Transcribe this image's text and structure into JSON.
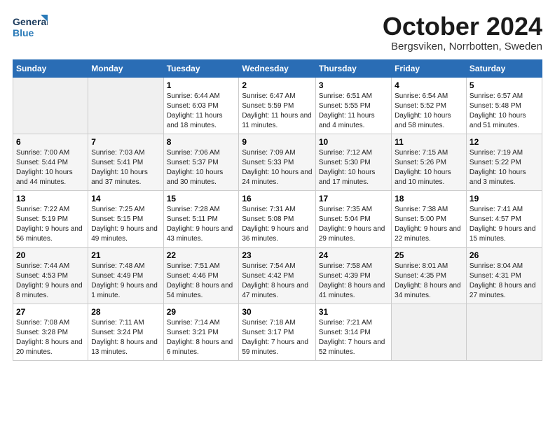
{
  "logo": {
    "line1": "General",
    "line2": "Blue"
  },
  "title": "October 2024",
  "subtitle": "Bergsviken, Norrbotten, Sweden",
  "days_header": [
    "Sunday",
    "Monday",
    "Tuesday",
    "Wednesday",
    "Thursday",
    "Friday",
    "Saturday"
  ],
  "weeks": [
    [
      {
        "day": "",
        "empty": true
      },
      {
        "day": "",
        "empty": true
      },
      {
        "day": "1",
        "sunrise": "6:44 AM",
        "sunset": "6:03 PM",
        "daylight": "11 hours and 18 minutes."
      },
      {
        "day": "2",
        "sunrise": "6:47 AM",
        "sunset": "5:59 PM",
        "daylight": "11 hours and 11 minutes."
      },
      {
        "day": "3",
        "sunrise": "6:51 AM",
        "sunset": "5:55 PM",
        "daylight": "11 hours and 4 minutes."
      },
      {
        "day": "4",
        "sunrise": "6:54 AM",
        "sunset": "5:52 PM",
        "daylight": "10 hours and 58 minutes."
      },
      {
        "day": "5",
        "sunrise": "6:57 AM",
        "sunset": "5:48 PM",
        "daylight": "10 hours and 51 minutes."
      }
    ],
    [
      {
        "day": "6",
        "sunrise": "7:00 AM",
        "sunset": "5:44 PM",
        "daylight": "10 hours and 44 minutes."
      },
      {
        "day": "7",
        "sunrise": "7:03 AM",
        "sunset": "5:41 PM",
        "daylight": "10 hours and 37 minutes."
      },
      {
        "day": "8",
        "sunrise": "7:06 AM",
        "sunset": "5:37 PM",
        "daylight": "10 hours and 30 minutes."
      },
      {
        "day": "9",
        "sunrise": "7:09 AM",
        "sunset": "5:33 PM",
        "daylight": "10 hours and 24 minutes."
      },
      {
        "day": "10",
        "sunrise": "7:12 AM",
        "sunset": "5:30 PM",
        "daylight": "10 hours and 17 minutes."
      },
      {
        "day": "11",
        "sunrise": "7:15 AM",
        "sunset": "5:26 PM",
        "daylight": "10 hours and 10 minutes."
      },
      {
        "day": "12",
        "sunrise": "7:19 AM",
        "sunset": "5:22 PM",
        "daylight": "10 hours and 3 minutes."
      }
    ],
    [
      {
        "day": "13",
        "sunrise": "7:22 AM",
        "sunset": "5:19 PM",
        "daylight": "9 hours and 56 minutes."
      },
      {
        "day": "14",
        "sunrise": "7:25 AM",
        "sunset": "5:15 PM",
        "daylight": "9 hours and 49 minutes."
      },
      {
        "day": "15",
        "sunrise": "7:28 AM",
        "sunset": "5:11 PM",
        "daylight": "9 hours and 43 minutes."
      },
      {
        "day": "16",
        "sunrise": "7:31 AM",
        "sunset": "5:08 PM",
        "daylight": "9 hours and 36 minutes."
      },
      {
        "day": "17",
        "sunrise": "7:35 AM",
        "sunset": "5:04 PM",
        "daylight": "9 hours and 29 minutes."
      },
      {
        "day": "18",
        "sunrise": "7:38 AM",
        "sunset": "5:00 PM",
        "daylight": "9 hours and 22 minutes."
      },
      {
        "day": "19",
        "sunrise": "7:41 AM",
        "sunset": "4:57 PM",
        "daylight": "9 hours and 15 minutes."
      }
    ],
    [
      {
        "day": "20",
        "sunrise": "7:44 AM",
        "sunset": "4:53 PM",
        "daylight": "9 hours and 8 minutes."
      },
      {
        "day": "21",
        "sunrise": "7:48 AM",
        "sunset": "4:49 PM",
        "daylight": "9 hours and 1 minute."
      },
      {
        "day": "22",
        "sunrise": "7:51 AM",
        "sunset": "4:46 PM",
        "daylight": "8 hours and 54 minutes."
      },
      {
        "day": "23",
        "sunrise": "7:54 AM",
        "sunset": "4:42 PM",
        "daylight": "8 hours and 47 minutes."
      },
      {
        "day": "24",
        "sunrise": "7:58 AM",
        "sunset": "4:39 PM",
        "daylight": "8 hours and 41 minutes."
      },
      {
        "day": "25",
        "sunrise": "8:01 AM",
        "sunset": "4:35 PM",
        "daylight": "8 hours and 34 minutes."
      },
      {
        "day": "26",
        "sunrise": "8:04 AM",
        "sunset": "4:31 PM",
        "daylight": "8 hours and 27 minutes."
      }
    ],
    [
      {
        "day": "27",
        "sunrise": "7:08 AM",
        "sunset": "3:28 PM",
        "daylight": "8 hours and 20 minutes."
      },
      {
        "day": "28",
        "sunrise": "7:11 AM",
        "sunset": "3:24 PM",
        "daylight": "8 hours and 13 minutes."
      },
      {
        "day": "29",
        "sunrise": "7:14 AM",
        "sunset": "3:21 PM",
        "daylight": "8 hours and 6 minutes."
      },
      {
        "day": "30",
        "sunrise": "7:18 AM",
        "sunset": "3:17 PM",
        "daylight": "7 hours and 59 minutes."
      },
      {
        "day": "31",
        "sunrise": "7:21 AM",
        "sunset": "3:14 PM",
        "daylight": "7 hours and 52 minutes."
      },
      {
        "day": "",
        "empty": true
      },
      {
        "day": "",
        "empty": true
      }
    ]
  ]
}
